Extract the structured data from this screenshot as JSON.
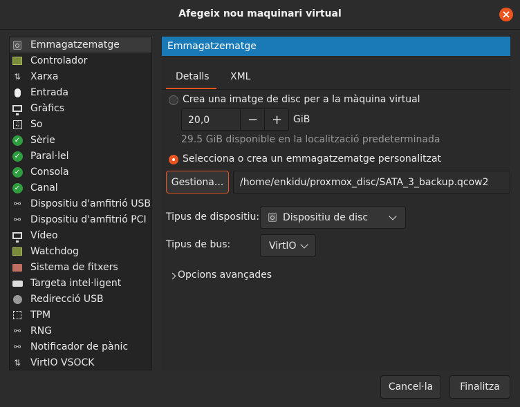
{
  "window": {
    "title": "Afegeix nou maquinari virtual"
  },
  "sidebar": {
    "items": [
      {
        "label": "Emmagatzematge",
        "icon": "hard-disk-icon"
      },
      {
        "label": "Controlador",
        "icon": "controller-chip-icon"
      },
      {
        "label": "Xarxa",
        "icon": "network-icon"
      },
      {
        "label": "Entrada",
        "icon": "mouse-icon"
      },
      {
        "label": "Gràfics",
        "icon": "monitor-icon"
      },
      {
        "label": "So",
        "icon": "sound-icon"
      },
      {
        "label": "Sèrie",
        "icon": "check-icon"
      },
      {
        "label": "Paral·lel",
        "icon": "check-icon"
      },
      {
        "label": "Consola",
        "icon": "check-icon"
      },
      {
        "label": "Canal",
        "icon": "check-icon"
      },
      {
        "label": "Dispositiu d'amfitrió USB",
        "icon": "host-device-icon"
      },
      {
        "label": "Dispositiu d'amfitrió PCI",
        "icon": "host-device-icon"
      },
      {
        "label": "Vídeo",
        "icon": "monitor-icon"
      },
      {
        "label": "Watchdog",
        "icon": "watchdog-chip-icon"
      },
      {
        "label": "Sistema de fitxers",
        "icon": "folder-icon"
      },
      {
        "label": "Targeta intel·ligent",
        "icon": "smartcard-icon"
      },
      {
        "label": "Redirecció USB",
        "icon": "usb-icon"
      },
      {
        "label": "TPM",
        "icon": "tpm-icon"
      },
      {
        "label": "RNG",
        "icon": "host-device-icon"
      },
      {
        "label": "Notificador de pànic",
        "icon": "host-device-icon"
      },
      {
        "label": "VirtIO VSOCK",
        "icon": "network-icon"
      }
    ]
  },
  "header": {
    "title": "Emmagatzematge"
  },
  "tabs": {
    "details": "Detalls",
    "xml": "XML"
  },
  "storage": {
    "create_disk_label": "Crea una imatge de disc per a la màquina virtual",
    "size_value": "20,0",
    "size_unit": "GiB",
    "available_text": "29.5 GiB disponible en la localització predeterminada",
    "custom_label": "Selecciona o crea un emmagatzematge personalitzat",
    "manage_button": "Gestiona...",
    "path_value": "/home/enkidu/proxmox_disc/SATA_3_backup.qcow2",
    "device_type_label": "Tipus de dispositiu:",
    "device_type_value": "Dispositiu de disc",
    "bus_type_label": "Tipus de bus:",
    "bus_type_value": "VirtIO",
    "advanced_label": "Opcions avançades"
  },
  "footer": {
    "cancel": "Cancel·la",
    "finish": "Finalitza"
  },
  "colors": {
    "accent": "#e95420",
    "header": "#1a7ab8",
    "check": "#2e9e3e"
  }
}
